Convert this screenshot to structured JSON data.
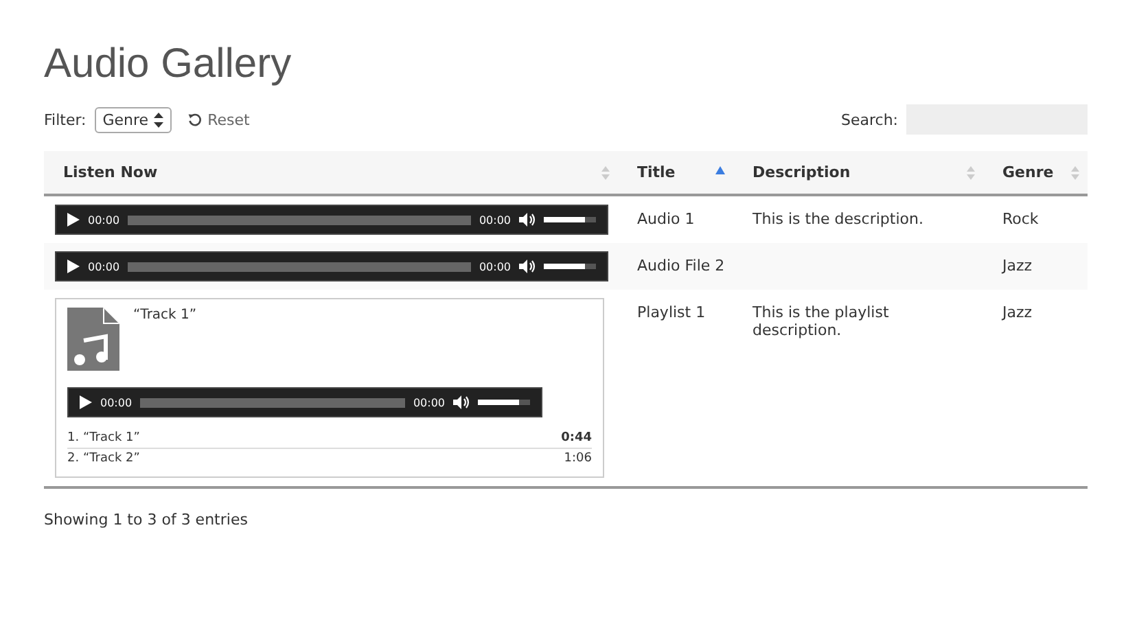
{
  "page": {
    "title": "Audio Gallery"
  },
  "filter": {
    "label": "Filter:",
    "value": "Genre",
    "reset": "Reset"
  },
  "search": {
    "label": "Search:"
  },
  "table": {
    "columns": [
      {
        "label": "Listen Now",
        "sorted": false
      },
      {
        "label": "Title",
        "sorted": true
      },
      {
        "label": "Description",
        "sorted": false
      },
      {
        "label": "Genre",
        "sorted": false
      }
    ],
    "rows": [
      {
        "media": {
          "kind": "player",
          "current": "00:00",
          "duration": "00:00",
          "volume": {
            "level": 0.8
          }
        },
        "title": "Audio 1",
        "description": "This is the description.",
        "genre": "Rock"
      },
      {
        "media": {
          "kind": "player",
          "current": "00:00",
          "duration": "00:00",
          "volume": {
            "level": 0.8
          }
        },
        "title": "Audio File 2",
        "genre": "Jazz"
      },
      {
        "media": {
          "kind": "playlist",
          "now_playing": "“Track 1”",
          "current": "00:00",
          "duration": "00:00",
          "volume": {
            "level": 0.8
          },
          "tracks": [
            {
              "name": "1. “Track 1”",
              "length": "0:44",
              "selected": true
            },
            {
              "name": "2. “Track 2”",
              "length": "1:06",
              "selected": false
            }
          ]
        },
        "title": "Playlist 1",
        "description": "This is the playlist description.",
        "genre": "Jazz"
      }
    ]
  },
  "footer": {
    "info": "Showing 1 to 3 of 3 entries"
  }
}
